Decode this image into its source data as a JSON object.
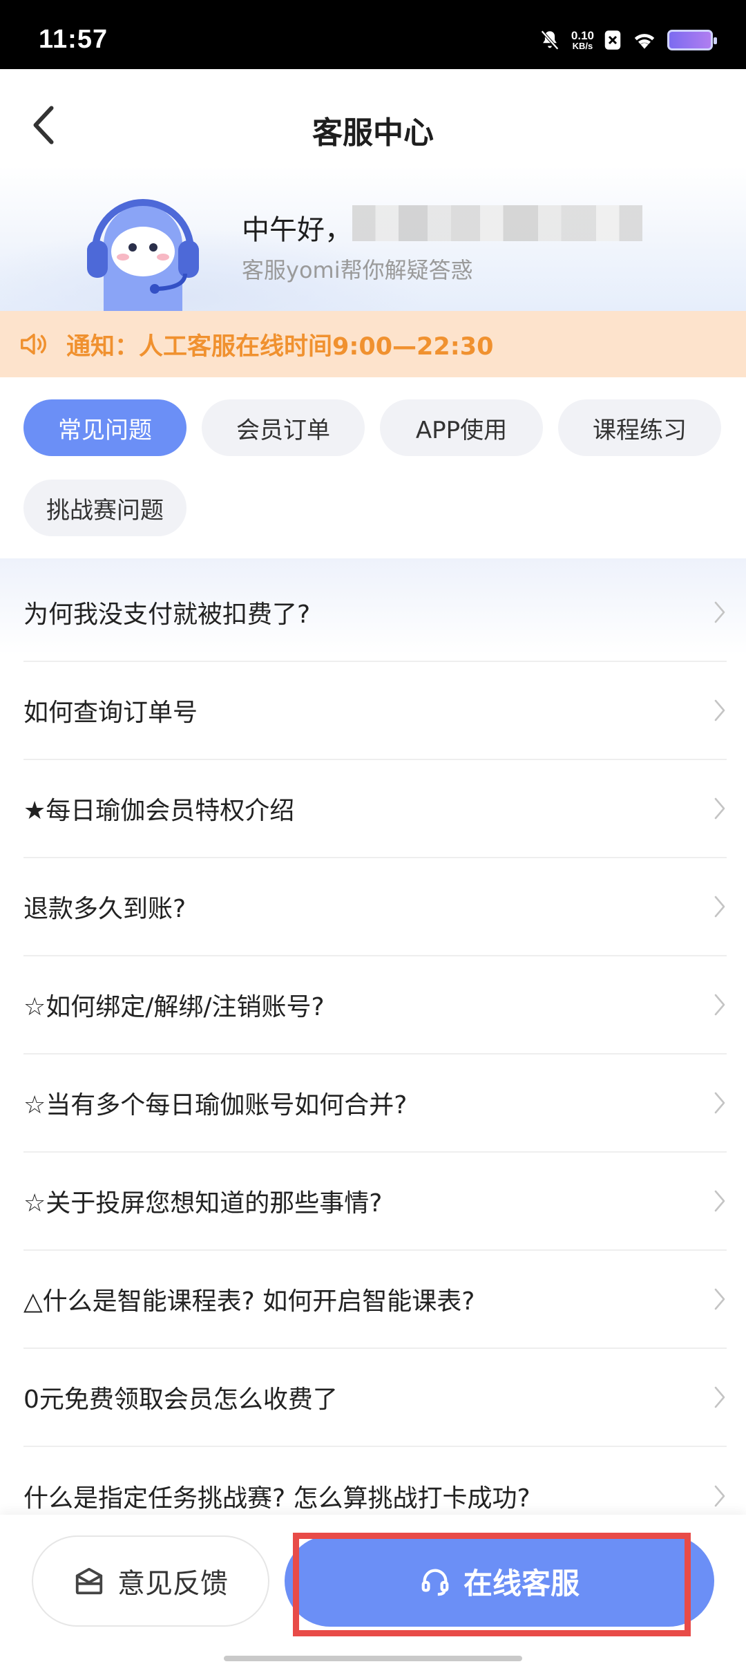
{
  "status_bar": {
    "time": "11:57",
    "net_speed_value": "0.10",
    "net_speed_unit": "KB/s"
  },
  "header": {
    "title": "客服中心"
  },
  "hero": {
    "greeting": "中午好，",
    "subtitle": "客服yomi帮你解疑答惑"
  },
  "notice": {
    "text": "通知：人工客服在线时间9:00—22:30"
  },
  "tabs": [
    {
      "label": "常见问题",
      "active": true
    },
    {
      "label": "会员订单",
      "active": false
    },
    {
      "label": "APP使用",
      "active": false
    },
    {
      "label": "课程练习",
      "active": false
    },
    {
      "label": "挑战赛问题",
      "active": false
    }
  ],
  "faq": [
    "为何我没支付就被扣费了?",
    "如何查询订单号",
    "★每日瑜伽会员特权介绍",
    "退款多久到账?",
    "☆如何绑定/解绑/注销账号?",
    "☆当有多个每日瑜伽账号如何合并?",
    "☆关于投屏您想知道的那些事情?",
    "△什么是智能课程表? 如何开启智能课表?",
    "0元免费领取会员怎么收费了",
    "什么是指定任务挑战赛? 怎么算挑战打卡成功?"
  ],
  "bottom": {
    "feedback_label": "意见反馈",
    "online_label": "在线客服"
  },
  "colors": {
    "accent": "#6b8ff6",
    "notice_bg": "#fde3cc",
    "notice_text": "#f0912f",
    "highlight": "#e84b48"
  }
}
